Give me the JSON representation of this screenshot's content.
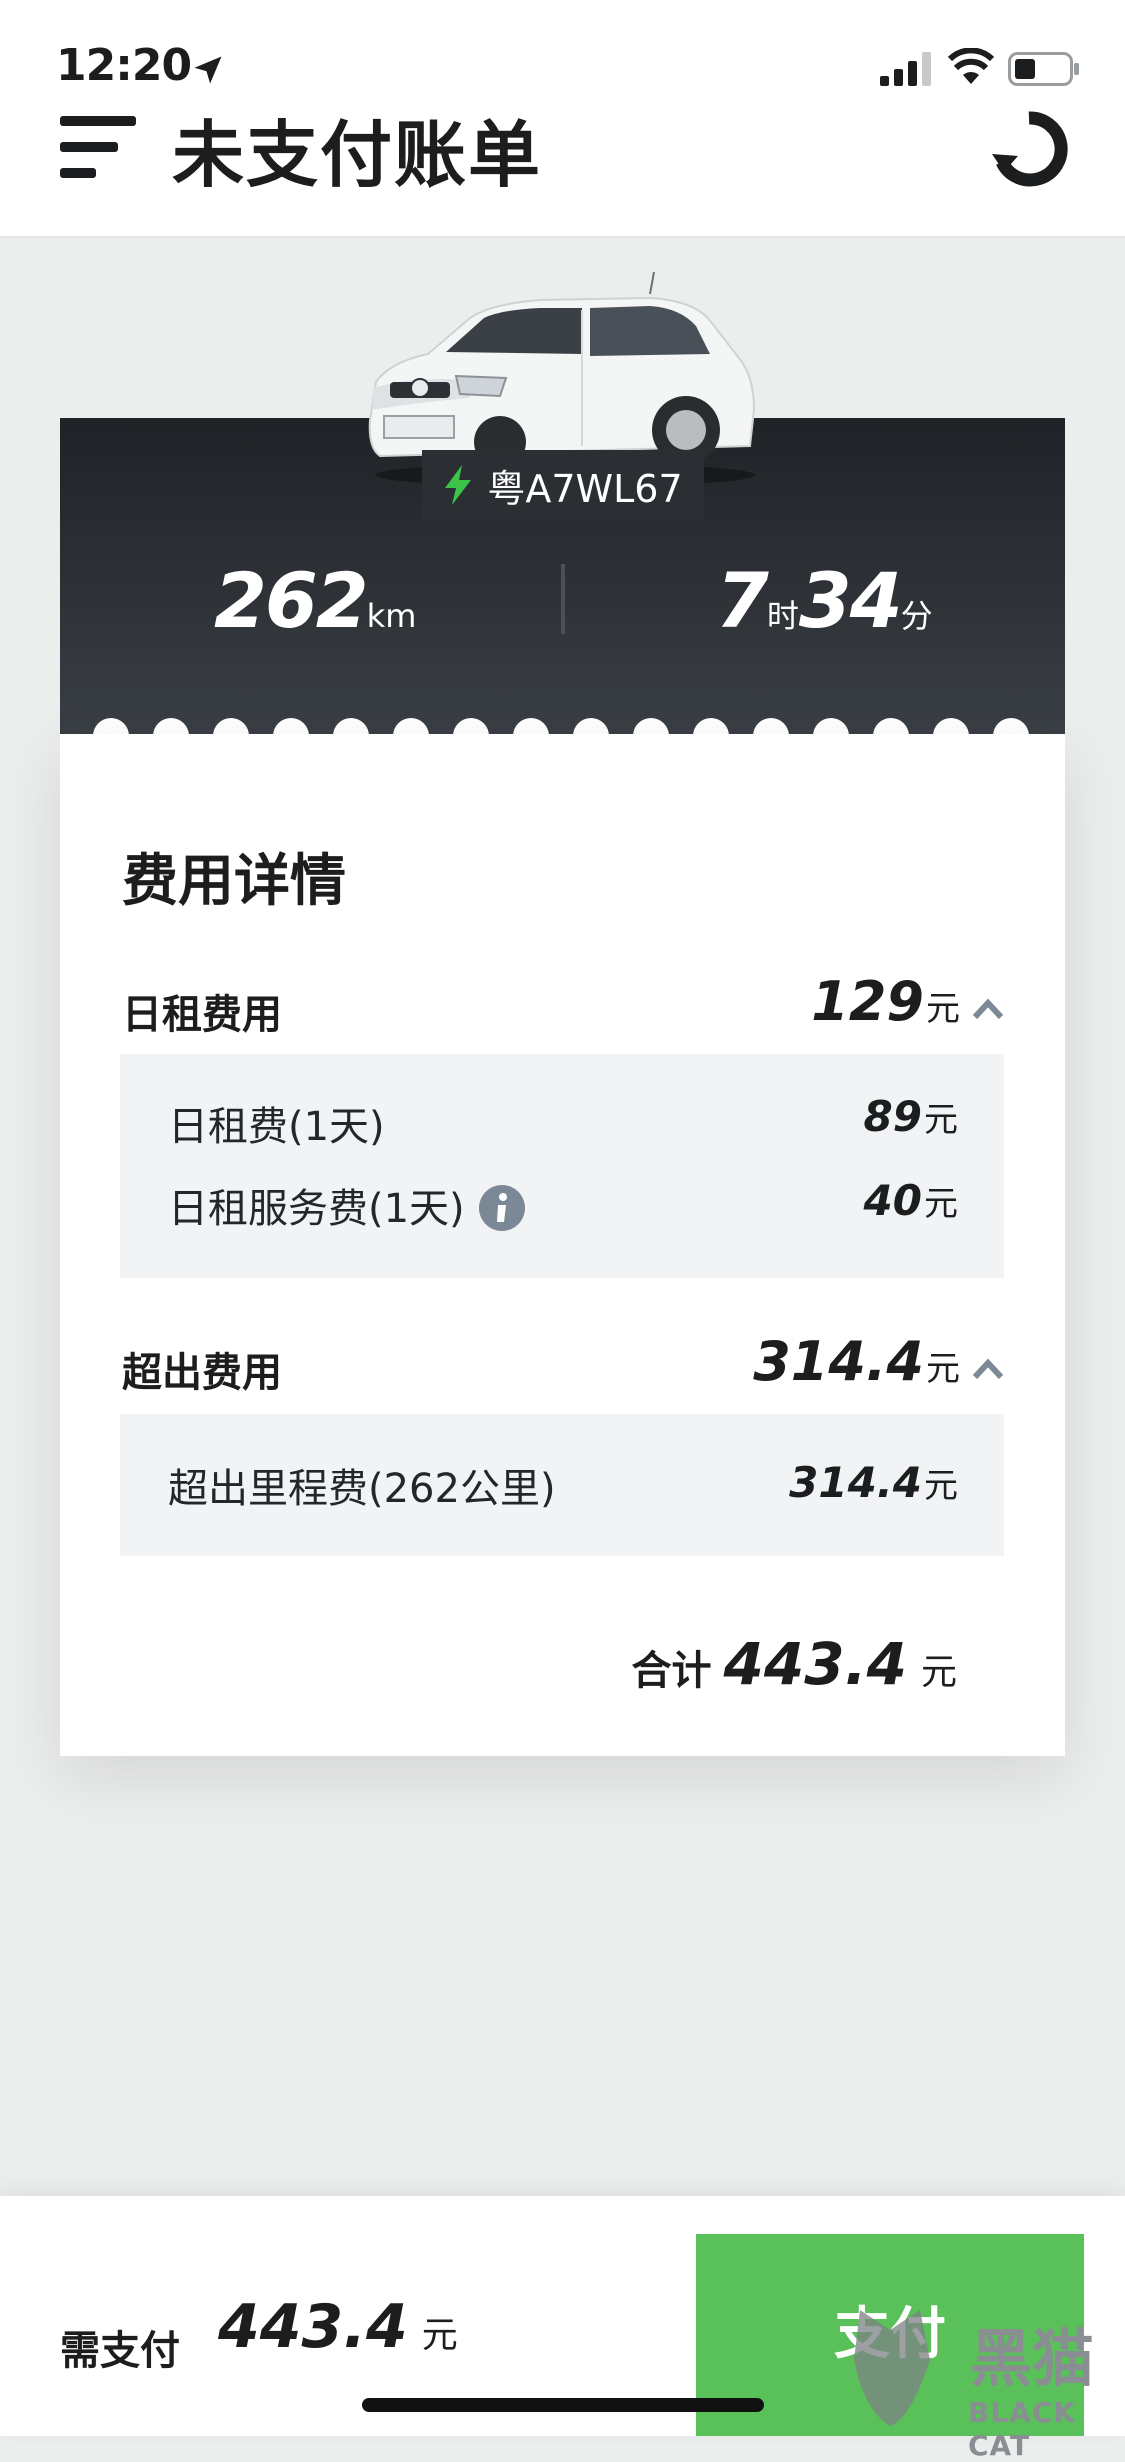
{
  "status_bar": {
    "time": "12:20"
  },
  "header": {
    "title": "未支付账单"
  },
  "car": {
    "plate": "粤A7WL67"
  },
  "trip": {
    "distance_value": "262",
    "distance_unit": "km",
    "hours_value": "7",
    "hours_unit": "时",
    "minutes_value": "34",
    "minutes_unit": "分"
  },
  "fees": {
    "title": "费用详情",
    "groups": [
      {
        "label": "日租费用",
        "amount": "129",
        "unit": "元",
        "items": [
          {
            "label": "日租费(1天)",
            "amount": "89",
            "unit": "元"
          },
          {
            "label": "日租服务费(1天)",
            "amount": "40",
            "unit": "元"
          }
        ]
      },
      {
        "label": "超出费用",
        "amount": "314.4",
        "unit": "元",
        "items": [
          {
            "label": "超出里程费(262公里)",
            "amount": "314.4",
            "unit": "元"
          }
        ]
      }
    ],
    "total_label": "合计",
    "total_amount": "443.4",
    "total_unit": "元"
  },
  "footer": {
    "due_label": "需支付",
    "due_amount": "443.4",
    "due_unit": "元",
    "pay_label": "支付"
  },
  "watermark": {
    "cn": "黑猫",
    "en": "BLACK CAT"
  },
  "colors": {
    "accent_green": "#5ac15a",
    "bolt_green": "#3cc34a",
    "dark_card": "#24282c"
  }
}
